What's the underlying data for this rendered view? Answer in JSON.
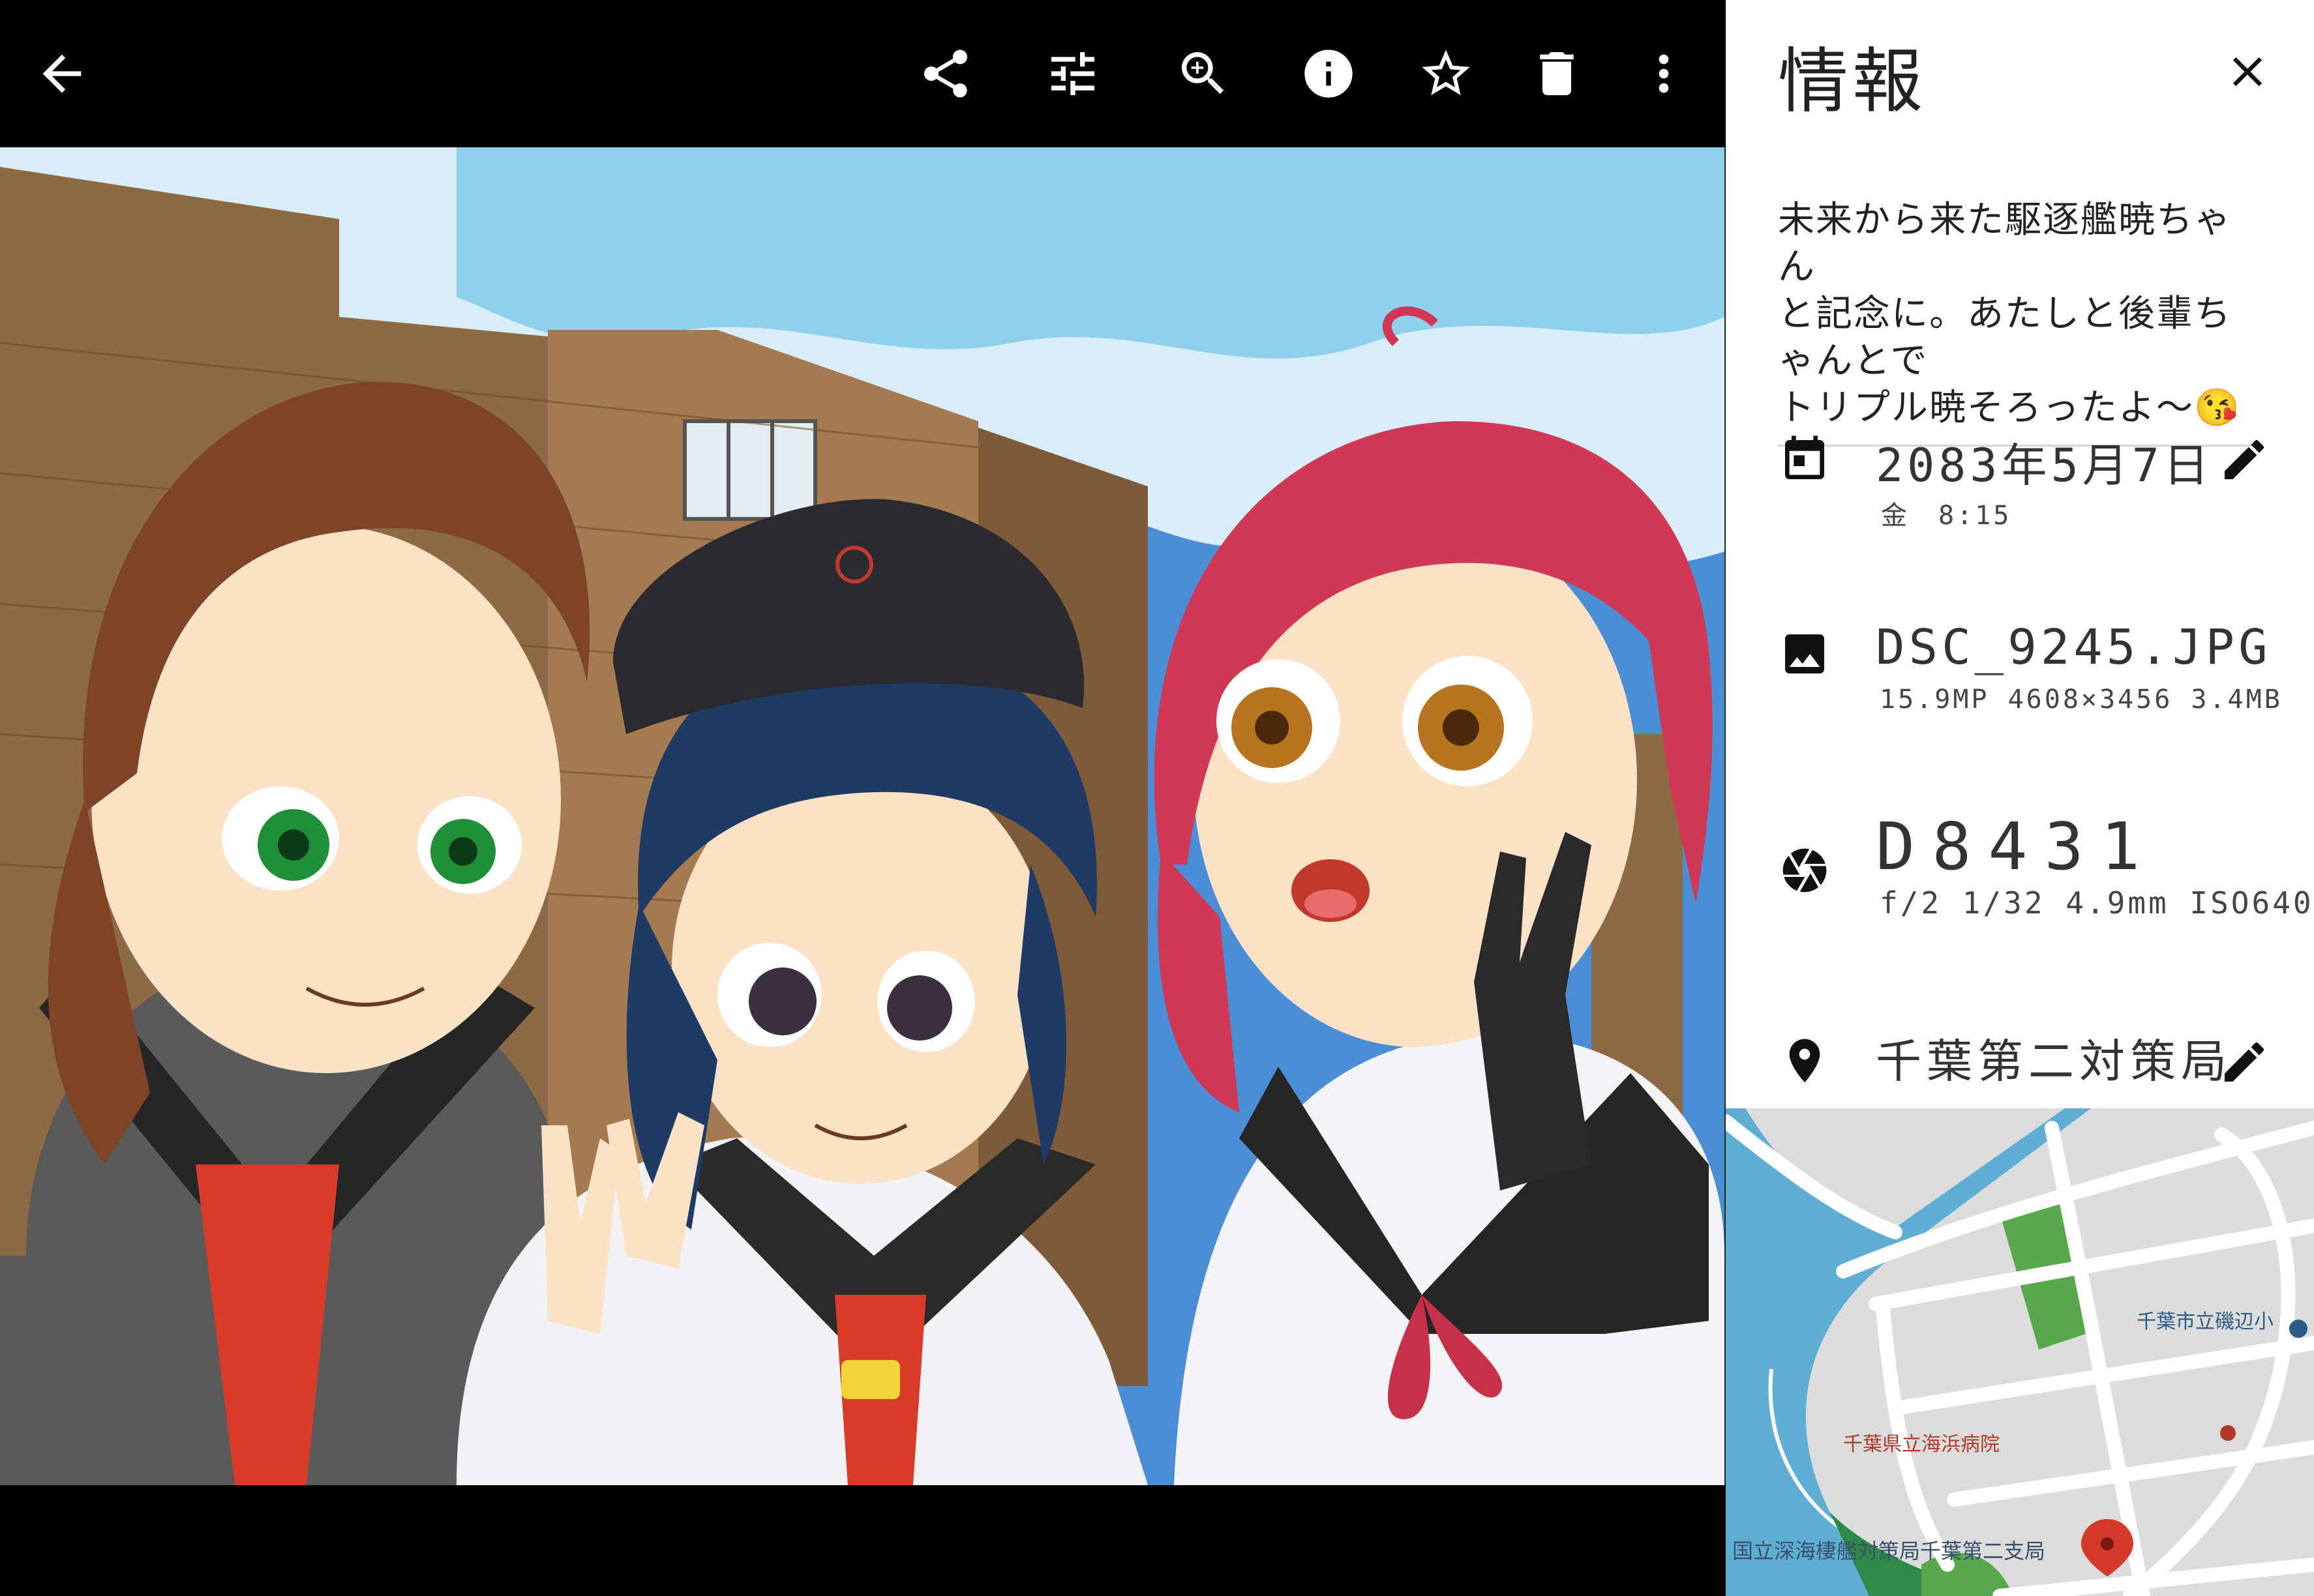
{
  "toolbar": {
    "icons": [
      "back-arrow-icon",
      "share-icon",
      "adjust-icon",
      "zoom-icon",
      "info-icon",
      "star-icon",
      "delete-icon",
      "more-icon"
    ]
  },
  "photo": {
    "description": "Anime illustration of three girls in sailor uniforms making peace signs in front of a brick building under a blue sky"
  },
  "panel": {
    "title": "情報",
    "description": "未来から来た駆逐艦暁ちゃん\nと記念に。あたしと後輩ちゃんとで\nトリプル暁そろったよ～😘",
    "date": {
      "main": "2083年5月7日",
      "sub": "金　8:15"
    },
    "file": {
      "name": "DSC_9245.JPG",
      "details": "15.9MP  4608×3456  3.4MB"
    },
    "camera": {
      "model": "D8431",
      "details": "f/2  1/32  4.9mm  ISO640"
    },
    "location": {
      "name": "千葉第二対策局"
    },
    "map": {
      "labels": {
        "school": "千葉市立磯辺小",
        "hospital": "千葉県立海浜病院",
        "office": "国立深海棲艦対策局千葉第二支局"
      },
      "colors": {
        "water": "#5eaed4",
        "land": "#dcdcdc",
        "park": "#5aa84e",
        "road": "#ffffff",
        "pin": "#d33a2c"
      }
    }
  }
}
